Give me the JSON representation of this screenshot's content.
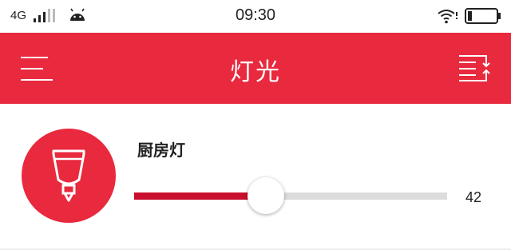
{
  "status_bar": {
    "network": "4G",
    "time": "09:30",
    "icons": [
      "signal-icon",
      "android-icon",
      "wifi-icon",
      "battery-icon"
    ]
  },
  "app_bar": {
    "title": "灯光",
    "background_color": "#e9293d",
    "left_icon": "menu-icon",
    "right_icon": "switch-icon"
  },
  "device": {
    "name": "厨房灯",
    "icon": "lamp-icon",
    "brightness": 42,
    "brightness_max": 100,
    "fill_color": "#c8102e"
  }
}
